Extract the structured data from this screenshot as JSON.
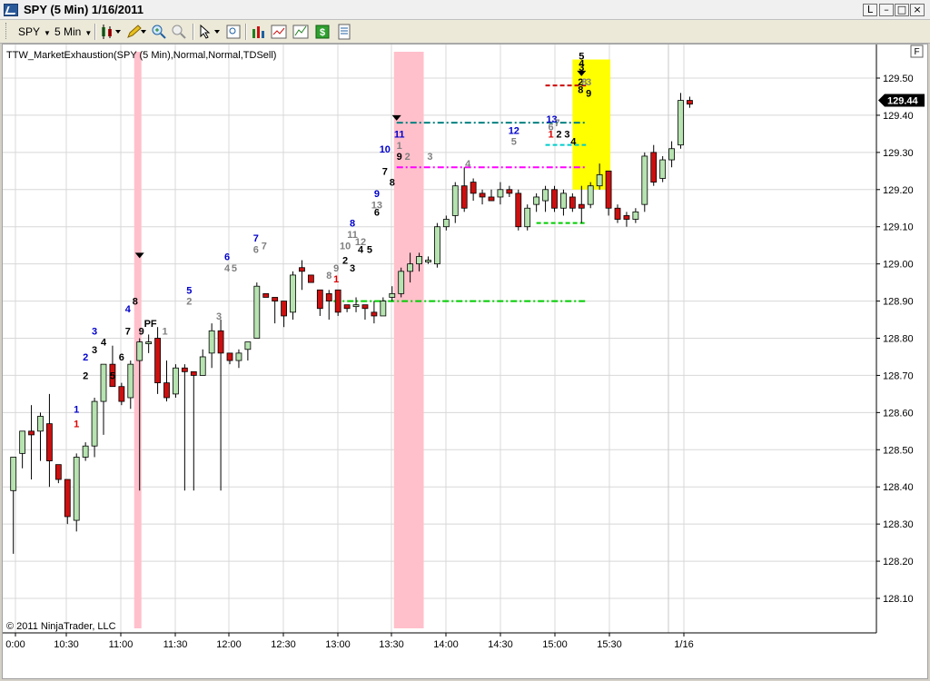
{
  "window": {
    "title": "SPY (5 Min)  1/16/2011"
  },
  "toolbar": {
    "instrument": "SPY",
    "interval": "5 Min"
  },
  "indicator_label": "TTW_MarketExhaustion(SPY (5 Min),Normal,Normal,TDSell)",
  "copyright": "© 2011 NinjaTrader, LLC",
  "price_marker": "129.44",
  "corner_button": "F",
  "colors": {
    "up_body": "#b6e3b0",
    "down_body": "#cc1010",
    "pink_zone": "#ffc0cb",
    "yellow_zone": "#ffff00",
    "blue_count": "#0000cc",
    "gray_count": "#808080",
    "red_count": "#dd0000"
  },
  "chart_data": {
    "type": "candlestick",
    "y_axis": {
      "min": 128.0,
      "max": 129.6,
      "ticks": [
        "129.50",
        "129.40",
        "129.30",
        "129.20",
        "129.10",
        "129.00",
        "128.90",
        "128.80",
        "128.70",
        "128.60",
        "128.50",
        "128.40",
        "128.30",
        "128.20",
        "128.10"
      ]
    },
    "x_axis": {
      "ticks": [
        "0:00",
        "10:30",
        "11:00",
        "11:30",
        "12:00",
        "12:30",
        "13:00",
        "13:30",
        "14:00",
        "14:30",
        "15:00",
        "15:30",
        "1/16"
      ]
    },
    "candles": [
      {
        "o": 128.39,
        "h": 128.48,
        "l": 128.22,
        "c": 128.48
      },
      {
        "o": 128.49,
        "h": 128.55,
        "l": 128.45,
        "c": 128.55
      },
      {
        "o": 128.55,
        "h": 128.62,
        "l": 128.42,
        "c": 128.54
      },
      {
        "o": 128.55,
        "h": 128.6,
        "l": 128.47,
        "c": 128.59
      },
      {
        "o": 128.57,
        "h": 128.65,
        "l": 128.4,
        "c": 128.47
      },
      {
        "o": 128.46,
        "h": 128.42,
        "l": 128.41,
        "c": 128.42
      },
      {
        "o": 128.42,
        "h": 128.42,
        "l": 128.3,
        "c": 128.32
      },
      {
        "o": 128.31,
        "h": 128.49,
        "l": 128.28,
        "c": 128.48
      },
      {
        "o": 128.48,
        "h": 128.52,
        "l": 128.47,
        "c": 128.51
      },
      {
        "o": 128.51,
        "h": 128.64,
        "l": 128.48,
        "c": 128.63
      },
      {
        "o": 128.63,
        "h": 128.73,
        "l": 128.54,
        "c": 128.73
      },
      {
        "o": 128.73,
        "h": 128.78,
        "l": 128.7,
        "c": 128.67
      },
      {
        "o": 128.67,
        "h": 128.68,
        "l": 128.62,
        "c": 128.63
      },
      {
        "o": 128.64,
        "h": 128.74,
        "l": 128.61,
        "c": 128.73
      },
      {
        "o": 128.74,
        "h": 128.8,
        "l": 128.39,
        "c": 128.79
      },
      {
        "o": 128.79,
        "h": 128.81,
        "l": 128.76,
        "c": 128.79
      },
      {
        "o": 128.8,
        "h": 128.83,
        "l": 128.65,
        "c": 128.68
      },
      {
        "o": 128.68,
        "h": 128.74,
        "l": 128.63,
        "c": 128.64
      },
      {
        "o": 128.65,
        "h": 128.73,
        "l": 128.64,
        "c": 128.72
      },
      {
        "o": 128.72,
        "h": 128.73,
        "l": 128.39,
        "c": 128.71
      },
      {
        "o": 128.71,
        "h": 128.7,
        "l": 128.39,
        "c": 128.7
      },
      {
        "o": 128.7,
        "h": 128.77,
        "l": 128.7,
        "c": 128.75
      },
      {
        "o": 128.76,
        "h": 128.84,
        "l": 128.72,
        "c": 128.82
      },
      {
        "o": 128.82,
        "h": 128.85,
        "l": 128.39,
        "c": 128.76
      },
      {
        "o": 128.76,
        "h": 128.76,
        "l": 128.73,
        "c": 128.74
      },
      {
        "o": 128.74,
        "h": 128.77,
        "l": 128.72,
        "c": 128.76
      },
      {
        "o": 128.77,
        "h": 128.79,
        "l": 128.74,
        "c": 128.79
      },
      {
        "o": 128.8,
        "h": 128.95,
        "l": 128.8,
        "c": 128.94
      },
      {
        "o": 128.92,
        "h": 128.92,
        "l": 128.91,
        "c": 128.91
      },
      {
        "o": 128.91,
        "h": 128.91,
        "l": 128.84,
        "c": 128.9
      },
      {
        "o": 128.9,
        "h": 128.9,
        "l": 128.83,
        "c": 128.86
      },
      {
        "o": 128.87,
        "h": 128.98,
        "l": 128.85,
        "c": 128.97
      },
      {
        "o": 128.99,
        "h": 129.01,
        "l": 128.93,
        "c": 128.98
      },
      {
        "o": 128.97,
        "h": 128.96,
        "l": 128.95,
        "c": 128.95
      },
      {
        "o": 128.93,
        "h": 128.93,
        "l": 128.86,
        "c": 128.88
      },
      {
        "o": 128.92,
        "h": 128.93,
        "l": 128.85,
        "c": 128.9
      },
      {
        "o": 128.93,
        "h": 128.93,
        "l": 128.86,
        "c": 128.87
      },
      {
        "o": 128.89,
        "h": 128.89,
        "l": 128.87,
        "c": 128.88
      },
      {
        "o": 128.89,
        "h": 128.91,
        "l": 128.87,
        "c": 128.89
      },
      {
        "o": 128.89,
        "h": 128.89,
        "l": 128.85,
        "c": 128.88
      },
      {
        "o": 128.87,
        "h": 128.9,
        "l": 128.84,
        "c": 128.86
      },
      {
        "o": 128.86,
        "h": 128.91,
        "l": 128.86,
        "c": 128.9
      },
      {
        "o": 128.91,
        "h": 128.94,
        "l": 128.9,
        "c": 128.92
      },
      {
        "o": 128.92,
        "h": 128.99,
        "l": 128.91,
        "c": 128.98
      },
      {
        "o": 128.98,
        "h": 129.03,
        "l": 128.95,
        "c": 129.0
      },
      {
        "o": 129.0,
        "h": 129.03,
        "l": 128.98,
        "c": 129.02
      },
      {
        "o": 129.01,
        "h": 129.02,
        "l": 129.0,
        "c": 129.01
      },
      {
        "o": 129.0,
        "h": 129.11,
        "l": 128.99,
        "c": 129.1
      },
      {
        "o": 129.1,
        "h": 129.13,
        "l": 129.09,
        "c": 129.12
      },
      {
        "o": 129.13,
        "h": 129.22,
        "l": 129.11,
        "c": 129.21
      },
      {
        "o": 129.21,
        "h": 129.26,
        "l": 129.14,
        "c": 129.15
      },
      {
        "o": 129.22,
        "h": 129.23,
        "l": 129.17,
        "c": 129.19
      },
      {
        "o": 129.19,
        "h": 129.2,
        "l": 129.16,
        "c": 129.18
      },
      {
        "o": 129.18,
        "h": 129.2,
        "l": 129.17,
        "c": 129.17
      },
      {
        "o": 129.18,
        "h": 129.22,
        "l": 129.16,
        "c": 129.2
      },
      {
        "o": 129.2,
        "h": 129.21,
        "l": 129.18,
        "c": 129.19
      },
      {
        "o": 129.19,
        "h": 129.2,
        "l": 129.09,
        "c": 129.1
      },
      {
        "o": 129.1,
        "h": 129.16,
        "l": 129.09,
        "c": 129.15
      },
      {
        "o": 129.16,
        "h": 129.19,
        "l": 129.14,
        "c": 129.18
      },
      {
        "o": 129.17,
        "h": 129.21,
        "l": 129.14,
        "c": 129.2
      },
      {
        "o": 129.2,
        "h": 129.21,
        "l": 129.14,
        "c": 129.15
      },
      {
        "o": 129.15,
        "h": 129.2,
        "l": 129.13,
        "c": 129.19
      },
      {
        "o": 129.18,
        "h": 129.19,
        "l": 129.14,
        "c": 129.15
      },
      {
        "o": 129.16,
        "h": 129.21,
        "l": 129.11,
        "c": 129.15
      },
      {
        "o": 129.16,
        "h": 129.22,
        "l": 129.15,
        "c": 129.21
      },
      {
        "o": 129.21,
        "h": 129.27,
        "l": 129.2,
        "c": 129.24
      },
      {
        "o": 129.25,
        "h": 129.25,
        "l": 129.13,
        "c": 129.15
      },
      {
        "o": 129.15,
        "h": 129.16,
        "l": 129.11,
        "c": 129.12
      },
      {
        "o": 129.13,
        "h": 129.14,
        "l": 129.1,
        "c": 129.12
      },
      {
        "o": 129.12,
        "h": 129.15,
        "l": 129.11,
        "c": 129.14
      },
      {
        "o": 129.16,
        "h": 129.3,
        "l": 129.14,
        "c": 129.29
      },
      {
        "o": 129.3,
        "h": 129.32,
        "l": 129.21,
        "c": 129.22
      },
      {
        "o": 129.23,
        "h": 129.29,
        "l": 129.22,
        "c": 129.28
      },
      {
        "o": 129.28,
        "h": 129.33,
        "l": 129.26,
        "c": 129.31
      },
      {
        "o": 129.32,
        "h": 129.46,
        "l": 129.31,
        "c": 129.44
      },
      {
        "o": 129.44,
        "h": 129.45,
        "l": 129.42,
        "c": 129.43
      }
    ],
    "shaded_zones": [
      {
        "from": 13.4,
        "to": 14.2,
        "color": "pink"
      },
      {
        "from": 42.2,
        "to": 45.5,
        "color": "pink"
      },
      {
        "from": 62.0,
        "to": 66.2,
        "color": "yellow",
        "ymin": 129.2,
        "ymax": 129.55
      }
    ],
    "levels": [
      {
        "price": 128.9,
        "from": 35.5,
        "to": 63.5,
        "color": "#00cc00",
        "style": "dash-dot"
      },
      {
        "price": 129.38,
        "from": 42.5,
        "to": 63.5,
        "color": "#008080",
        "style": "dash-dot"
      },
      {
        "price": 129.26,
        "from": 42.5,
        "to": 63.5,
        "color": "#ff00ff",
        "style": "dash-dot"
      },
      {
        "price": 129.48,
        "from": 59.0,
        "to": 63.5,
        "color": "#cc0000",
        "style": "dash"
      },
      {
        "price": 129.32,
        "from": 59.0,
        "to": 63.5,
        "color": "#00cccc",
        "style": "dash"
      },
      {
        "price": 129.11,
        "from": 58.0,
        "to": 63.5,
        "color": "#00cc00",
        "style": "dash"
      }
    ],
    "markers": [
      {
        "x": 14.0,
        "price": 129.03,
        "shape": "down-triangle"
      },
      {
        "x": 42.5,
        "price": 129.4,
        "shape": "down-triangle"
      },
      {
        "x": 63.0,
        "price": 129.52,
        "shape": "down-triangle"
      }
    ],
    "annotations": [
      {
        "x": 7.0,
        "price": 128.6,
        "text": "1",
        "color": "blue"
      },
      {
        "x": 7.0,
        "price": 128.56,
        "text": "1",
        "color": "red"
      },
      {
        "x": 8.0,
        "price": 128.74,
        "text": "2",
        "color": "blue"
      },
      {
        "x": 8.0,
        "price": 128.69,
        "text": "2",
        "color": "black"
      },
      {
        "x": 9.0,
        "price": 128.81,
        "text": "3",
        "color": "blue"
      },
      {
        "x": 9.0,
        "price": 128.76,
        "text": "3",
        "color": "black"
      },
      {
        "x": 10.0,
        "price": 128.78,
        "text": "4",
        "color": "black"
      },
      {
        "x": 11.0,
        "price": 128.69,
        "text": "5",
        "color": "black"
      },
      {
        "x": 12.0,
        "price": 128.74,
        "text": "6",
        "color": "black"
      },
      {
        "x": 12.7,
        "price": 128.81,
        "text": "7",
        "color": "black"
      },
      {
        "x": 12.7,
        "price": 128.87,
        "text": "4",
        "color": "blue"
      },
      {
        "x": 13.5,
        "price": 128.89,
        "text": "8",
        "color": "black"
      },
      {
        "x": 14.2,
        "price": 128.81,
        "text": "9",
        "color": "black"
      },
      {
        "x": 15.2,
        "price": 128.83,
        "text": "PF",
        "color": "black"
      },
      {
        "x": 16.8,
        "price": 128.81,
        "text": "1",
        "color": "gray"
      },
      {
        "x": 19.5,
        "price": 128.92,
        "text": "5",
        "color": "blue"
      },
      {
        "x": 19.5,
        "price": 128.89,
        "text": "2",
        "color": "gray"
      },
      {
        "x": 22.8,
        "price": 128.85,
        "text": "3",
        "color": "gray"
      },
      {
        "x": 23.7,
        "price": 129.01,
        "text": "6",
        "color": "blue"
      },
      {
        "x": 23.7,
        "price": 128.98,
        "text": "4",
        "color": "gray"
      },
      {
        "x": 24.5,
        "price": 128.98,
        "text": "5",
        "color": "gray"
      },
      {
        "x": 26.9,
        "price": 129.06,
        "text": "7",
        "color": "blue"
      },
      {
        "x": 26.9,
        "price": 129.03,
        "text": "6",
        "color": "gray"
      },
      {
        "x": 27.8,
        "price": 129.04,
        "text": "7",
        "color": "gray"
      },
      {
        "x": 35.0,
        "price": 128.96,
        "text": "8",
        "color": "gray"
      },
      {
        "x": 35.8,
        "price": 128.98,
        "text": "9",
        "color": "gray"
      },
      {
        "x": 35.8,
        "price": 128.95,
        "text": "1",
        "color": "red"
      },
      {
        "x": 36.8,
        "price": 129.04,
        "text": "10",
        "color": "gray"
      },
      {
        "x": 36.8,
        "price": 129.0,
        "text": "2",
        "color": "black"
      },
      {
        "x": 37.6,
        "price": 129.1,
        "text": "8",
        "color": "blue"
      },
      {
        "x": 37.6,
        "price": 129.07,
        "text": "11",
        "color": "gray"
      },
      {
        "x": 37.6,
        "price": 128.98,
        "text": "3",
        "color": "black"
      },
      {
        "x": 38.5,
        "price": 129.05,
        "text": "12",
        "color": "gray"
      },
      {
        "x": 38.5,
        "price": 129.03,
        "text": "4",
        "color": "black"
      },
      {
        "x": 39.5,
        "price": 129.03,
        "text": "5",
        "color": "black"
      },
      {
        "x": 40.3,
        "price": 129.18,
        "text": "9",
        "color": "blue"
      },
      {
        "x": 40.3,
        "price": 129.15,
        "text": "13",
        "color": "gray"
      },
      {
        "x": 40.3,
        "price": 129.13,
        "text": "6",
        "color": "black"
      },
      {
        "x": 41.2,
        "price": 129.24,
        "text": "7",
        "color": "black"
      },
      {
        "x": 41.2,
        "price": 129.3,
        "text": "10",
        "color": "blue"
      },
      {
        "x": 42.0,
        "price": 129.21,
        "text": "8",
        "color": "black"
      },
      {
        "x": 42.8,
        "price": 129.34,
        "text": "11",
        "color": "blue"
      },
      {
        "x": 42.8,
        "price": 129.31,
        "text": "1",
        "color": "gray"
      },
      {
        "x": 42.8,
        "price": 129.28,
        "text": "9",
        "color": "black"
      },
      {
        "x": 43.7,
        "price": 129.28,
        "text": "2",
        "color": "gray"
      },
      {
        "x": 46.2,
        "price": 129.28,
        "text": "3",
        "color": "gray"
      },
      {
        "x": 50.4,
        "price": 129.26,
        "text": "4",
        "color": "gray"
      },
      {
        "x": 55.5,
        "price": 129.35,
        "text": "12",
        "color": "blue"
      },
      {
        "x": 55.5,
        "price": 129.32,
        "text": "5",
        "color": "gray"
      },
      {
        "x": 59.7,
        "price": 129.38,
        "text": "13",
        "color": "blue"
      },
      {
        "x": 59.6,
        "price": 129.36,
        "text": "6",
        "color": "gray"
      },
      {
        "x": 60.3,
        "price": 129.37,
        "text": "7",
        "color": "gray"
      },
      {
        "x": 59.6,
        "price": 129.34,
        "text": "1",
        "color": "red"
      },
      {
        "x": 60.5,
        "price": 129.34,
        "text": "2",
        "color": "black"
      },
      {
        "x": 61.4,
        "price": 129.34,
        "text": "3",
        "color": "black"
      },
      {
        "x": 62.1,
        "price": 129.32,
        "text": "4",
        "color": "black"
      },
      {
        "x": 63.0,
        "price": 129.55,
        "text": "5",
        "color": "black"
      },
      {
        "x": 63.0,
        "price": 129.53,
        "text": "4",
        "color": "black"
      },
      {
        "x": 63.0,
        "price": 129.52,
        "text": "3",
        "color": "black"
      },
      {
        "x": 62.9,
        "price": 129.48,
        "text": "2",
        "color": "black"
      },
      {
        "x": 63.8,
        "price": 129.48,
        "text": "3",
        "color": "gray"
      },
      {
        "x": 63.3,
        "price": 129.48,
        "text": "8",
        "color": "gray"
      },
      {
        "x": 62.9,
        "price": 129.46,
        "text": "8",
        "color": "black"
      },
      {
        "x": 63.8,
        "price": 129.45,
        "text": "9",
        "color": "black"
      }
    ]
  }
}
